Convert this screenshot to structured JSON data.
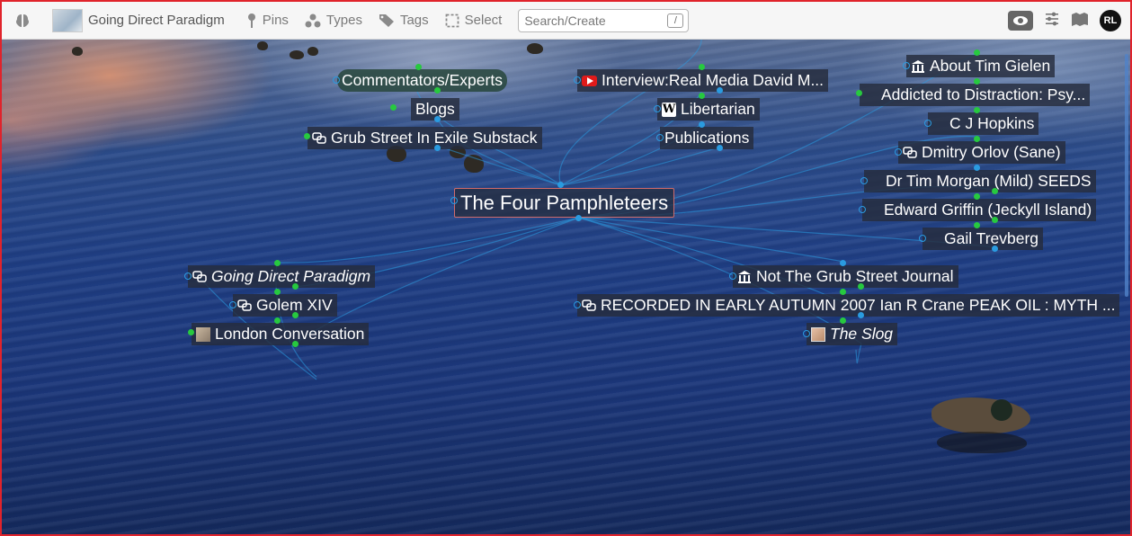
{
  "toolbar": {
    "title": "Going Direct Paradigm",
    "pins_label": "Pins",
    "types_label": "Types",
    "tags_label": "Tags",
    "select_label": "Select",
    "search_placeholder": "Search/Create",
    "search_shortcut": "/",
    "avatar_initials": "RL"
  },
  "graph": {
    "center": "The Four Pamphleteers",
    "nodes": {
      "commentators": "Commentators/Experts",
      "blogs": "Blogs",
      "grub_street_exile": "Grub Street In Exile Substack",
      "interview": "Interview:Real Media David M...",
      "libertarian": "Libertarian",
      "publications": "Publications",
      "tim_gielen": "About Tim Gielen",
      "addicted": "Addicted to Distraction: Psy...",
      "cj_hopkins": "C J Hopkins",
      "dmitry_orlov": "Dmitry Orlov (Sane)",
      "tim_morgan": "Dr Tim Morgan (Mild) SEEDS",
      "edward_griffin": "Edward Griffin (Jeckyll Island)",
      "gail_trevberg": "Gail Trevberg",
      "going_direct": "Going Direct Paradigm",
      "golem": "Golem XIV",
      "london_conv": "London Conversation",
      "not_grub": "Not The Grub Street Journal",
      "recorded": "RECORDED IN EARLY AUTUMN 2007 Ian R Crane PEAK OIL : MYTH ...",
      "slog": "The Slog"
    }
  },
  "colors": {
    "accent_green": "#27c93f",
    "accent_blue": "#2a9be0",
    "center_border": "#d06b6b"
  }
}
